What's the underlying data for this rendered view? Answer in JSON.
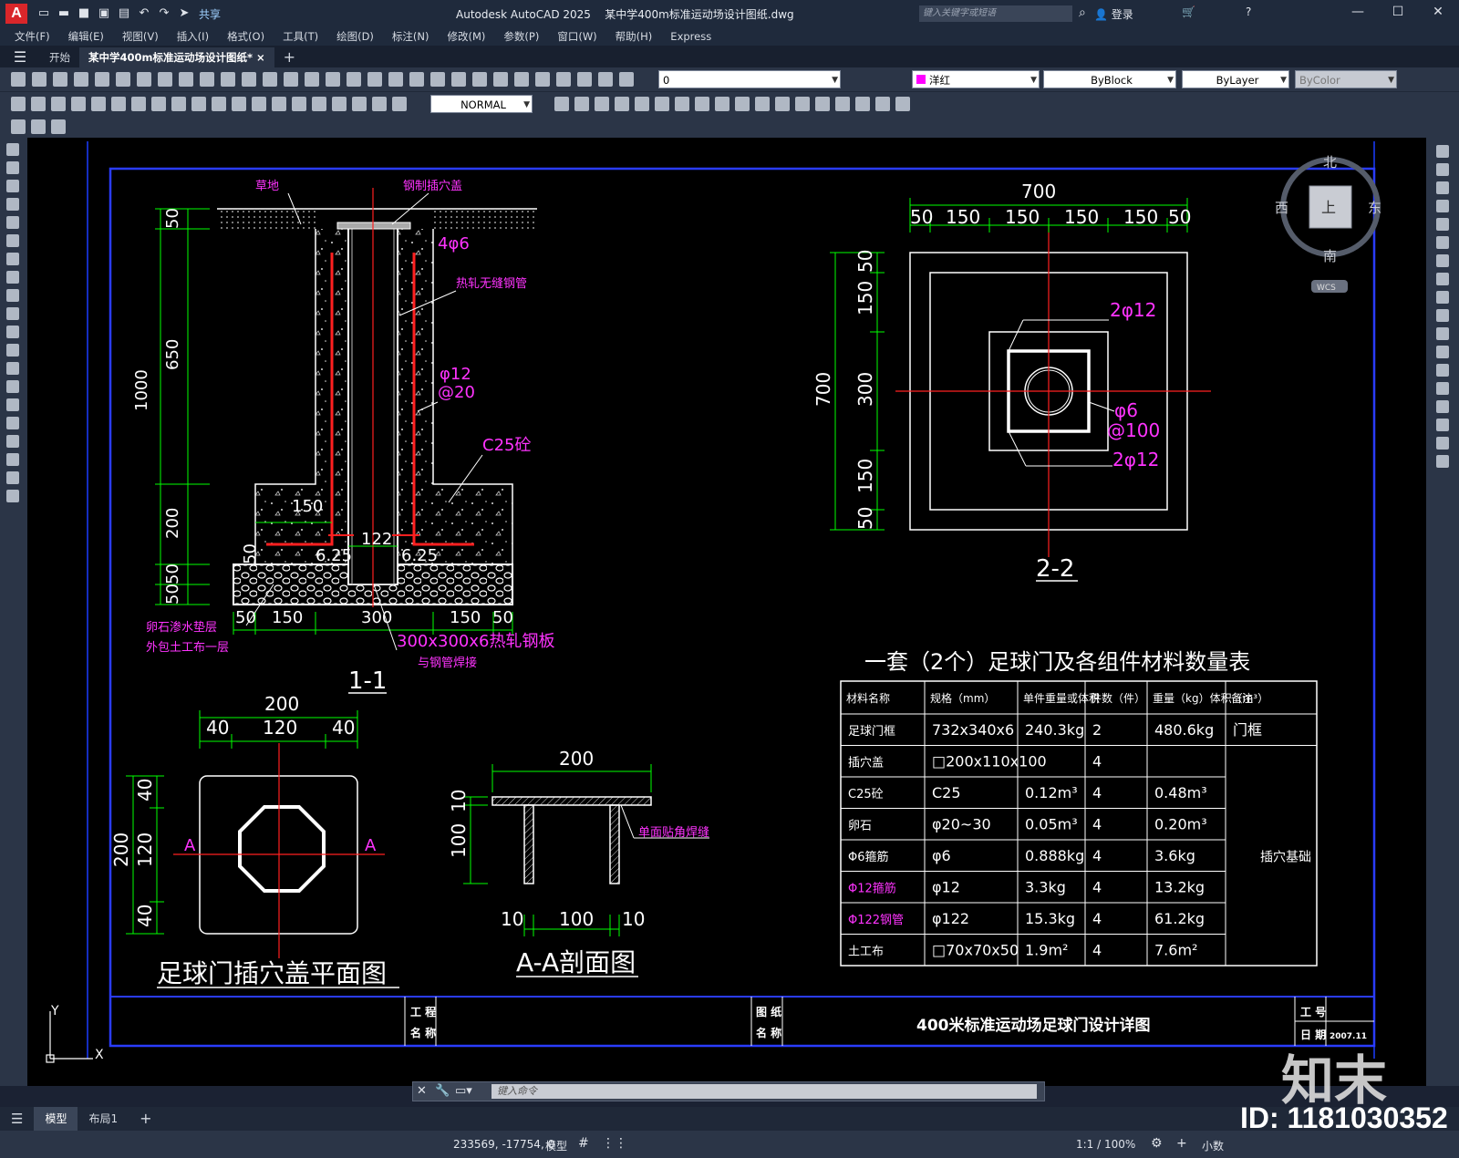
{
  "app": {
    "logo": "A",
    "title": "Autodesk AutoCAD 2025",
    "filename": "某中学400m标准运动场设计图纸.dwg",
    "share": "共享",
    "search_placeholder": "键入关键字或短语",
    "login": "登录"
  },
  "menu": [
    "文件(F)",
    "编辑(E)",
    "视图(V)",
    "插入(I)",
    "格式(O)",
    "工具(T)",
    "绘图(D)",
    "标注(N)",
    "修改(M)",
    "参数(P)",
    "窗口(W)",
    "帮助(H)",
    "Express"
  ],
  "tabs": {
    "start": "开始",
    "doc": "某中学400m标准运动场设计图纸*",
    "close": "×",
    "add": "+"
  },
  "toolbar": {
    "layer": "0",
    "color": "洋红",
    "linetype": "ByBlock",
    "lineweight": "ByLayer",
    "plotstyle": "ByColor",
    "dimstyle": "NORMAL"
  },
  "viewcube": {
    "north": "北",
    "south": "南",
    "east": "东",
    "west": "西",
    "top": "上",
    "wcs": "WCS"
  },
  "drawing": {
    "s11": {
      "title": "1-1",
      "grass": "草地",
      "cover": "钢制插穴盖",
      "bars": "4φ6",
      "pipe": "热轧无缝钢管",
      "hoop1": "φ12",
      "hoop2": "@20",
      "concrete": "C25砼",
      "d1000": "1000",
      "d650": "650",
      "d200": "200",
      "d50a": "50",
      "d50b": "50",
      "d50c": "50",
      "d50d": "50",
      "d150": "150",
      "d122": "122",
      "d625a": "6.25",
      "d625b": "6.25",
      "b50a": "50",
      "b150a": "150",
      "b300": "300",
      "b150b": "150",
      "b50b": "50",
      "gravel1": "卵石渗水垫层",
      "gravel2": "外包土工布一层",
      "plate1": "300x300x6热轧钢板",
      "plate2": "与钢管焊接"
    },
    "s22": {
      "title": "2-2",
      "w700": "700",
      "t50a": "50",
      "t150a": "150",
      "t150b": "150",
      "t150c": "150",
      "t150d": "150",
      "t50b": "50",
      "h700": "700",
      "v50a": "50",
      "v150a": "150",
      "v300": "300",
      "v150b": "150",
      "v50b": "50",
      "r1": "2φ12",
      "r2": "φ6",
      "r3": "@100",
      "r4": "2φ12"
    },
    "plan": {
      "title": "足球门插穴盖平面图",
      "w200": "200",
      "w40a": "40",
      "w120": "120",
      "w40b": "40",
      "h200": "200",
      "h40a": "40",
      "h120": "120",
      "h40b": "40",
      "a1": "A",
      "a2": "A"
    },
    "aa": {
      "title": "A-A剖面图",
      "w200": "200",
      "h10": "10",
      "h100": "100",
      "b10a": "10",
      "b100": "100",
      "b10b": "10",
      "weld": "单面贴角焊缝"
    },
    "table": {
      "title": "一套（2个）足球门及各组件材料数量表",
      "headers": [
        "材料名称",
        "规格（mm）",
        "单件重量或体积",
        "件数（件）",
        "重量（kg）体积（m³）",
        "备注"
      ],
      "rows": [
        [
          "足球门框",
          "732x340x6",
          "240.3kg",
          "2",
          "480.6kg",
          "门框"
        ],
        [
          "插穴盖",
          "□200x110x100",
          "",
          "4",
          "",
          ""
        ],
        [
          "C25砼",
          "C25",
          "0.12m³",
          "4",
          "0.48m³",
          ""
        ],
        [
          "卵石",
          "φ20~30",
          "0.05m³",
          "4",
          "0.20m³",
          ""
        ],
        [
          "Φ6箍筋",
          "φ6",
          "0.888kg",
          "4",
          "3.6kg",
          ""
        ],
        [
          "Φ12箍筋",
          "φ12",
          "3.3kg",
          "4",
          "13.2kg",
          ""
        ],
        [
          "Φ122钢管",
          "φ122",
          "15.3kg",
          "4",
          "61.2kg",
          ""
        ],
        [
          "土工布",
          "□70x70x50",
          "1.9m²",
          "4",
          "7.6m²",
          ""
        ]
      ],
      "merged_note": "插穴基础"
    },
    "titleblock": {
      "proj1": "工 程",
      "proj2": "名 称",
      "fig1": "图 纸",
      "fig2": "名 称",
      "drawing_name": "400米标准运动场足球门设计详图",
      "job": "工 号",
      "date_label": "日 期",
      "date": "2007.11"
    },
    "ucs": {
      "x": "X",
      "y": "Y"
    }
  },
  "cmd": {
    "placeholder": "键入命令"
  },
  "layouts": {
    "model": "模型",
    "layout1": "布局1",
    "add": "+"
  },
  "status": {
    "coords": "233569, -17754, 0",
    "model": "模型",
    "scale": "1:1 / 100%",
    "units": "小数"
  },
  "watermark": {
    "id": "ID: 1181030352",
    "brand": "知末"
  }
}
